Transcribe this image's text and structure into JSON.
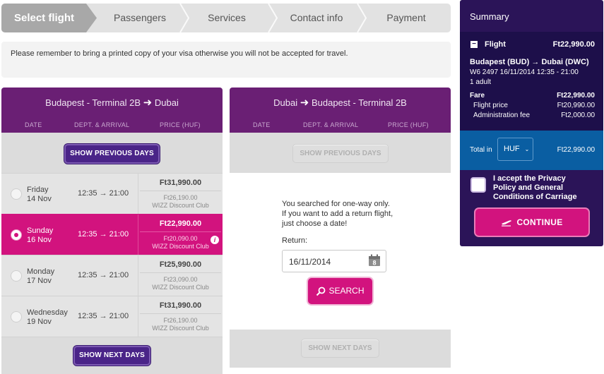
{
  "steps": [
    "Select flight",
    "Passengers",
    "Services",
    "Contact info",
    "Payment"
  ],
  "notice": "Please remember to bring a printed copy of your visa otherwise you will not be accepted for travel.",
  "columns": {
    "labels": {
      "date": "DATE",
      "dept": "DEPT. & ARRIVAL",
      "price": "PRICE (HUF)"
    },
    "outbound": {
      "from": "Budapest - Terminal 2B",
      "to": "Dubai",
      "show_previous": "SHOW PREVIOUS DAYS",
      "show_next": "SHOW NEXT DAYS",
      "rows": [
        {
          "day": "Friday",
          "date": "14 Nov",
          "time": "12:35 → 21:00",
          "price": "Ft31,990.00",
          "club_price": "Ft26,190.00",
          "club": "WIZZ Discount Club",
          "selected": false
        },
        {
          "day": "Sunday",
          "date": "16 Nov",
          "time": "12:35 → 21:00",
          "price": "Ft22,990.00",
          "club_price": "Ft20,090.00",
          "club": "WIZZ Discount Club",
          "selected": true
        },
        {
          "day": "Monday",
          "date": "17 Nov",
          "time": "12:35 → 21:00",
          "price": "Ft25,990.00",
          "club_price": "Ft23,090.00",
          "club": "WIZZ Discount Club",
          "selected": false
        },
        {
          "day": "Wednesday",
          "date": "19 Nov",
          "time": "12:35 → 21:00",
          "price": "Ft31,990.00",
          "club_price": "Ft26,190.00",
          "club": "WIZZ Discount Club",
          "selected": false
        }
      ]
    },
    "return": {
      "from": "Dubai",
      "to": "Budapest - Terminal 2B",
      "show_previous": "SHOW PREVIOUS DAYS",
      "show_next": "SHOW NEXT DAYS",
      "msg1": "You searched for one-way only.",
      "msg2": "If you want to add a return flight,",
      "msg3": "just choose a date!",
      "return_label": "Return:",
      "return_value": "16/11/2014",
      "calendar_day": "8",
      "search": "SEARCH"
    }
  },
  "summary": {
    "title": "Summary",
    "flight_label": "Flight",
    "flight_total": "Ft22,990.00",
    "route": "Budapest (BUD) → Dubai (DWC)",
    "details": "W6 2497  16/11/2014 12:35 - 21:00",
    "pax": "1 adult",
    "fare_label": "Fare",
    "fare": "Ft22,990.00",
    "flight_price_label": "Flight price",
    "flight_price": "Ft20,990.00",
    "admin_label": "Administration fee",
    "admin": "Ft2,000.00",
    "total_label": "Total in",
    "currency": "HUF",
    "total": "Ft22,990.00",
    "accept": [
      "I accept the Privacy",
      "Policy and General",
      "Conditions of Carriage"
    ],
    "continue": "CONTINUE"
  }
}
